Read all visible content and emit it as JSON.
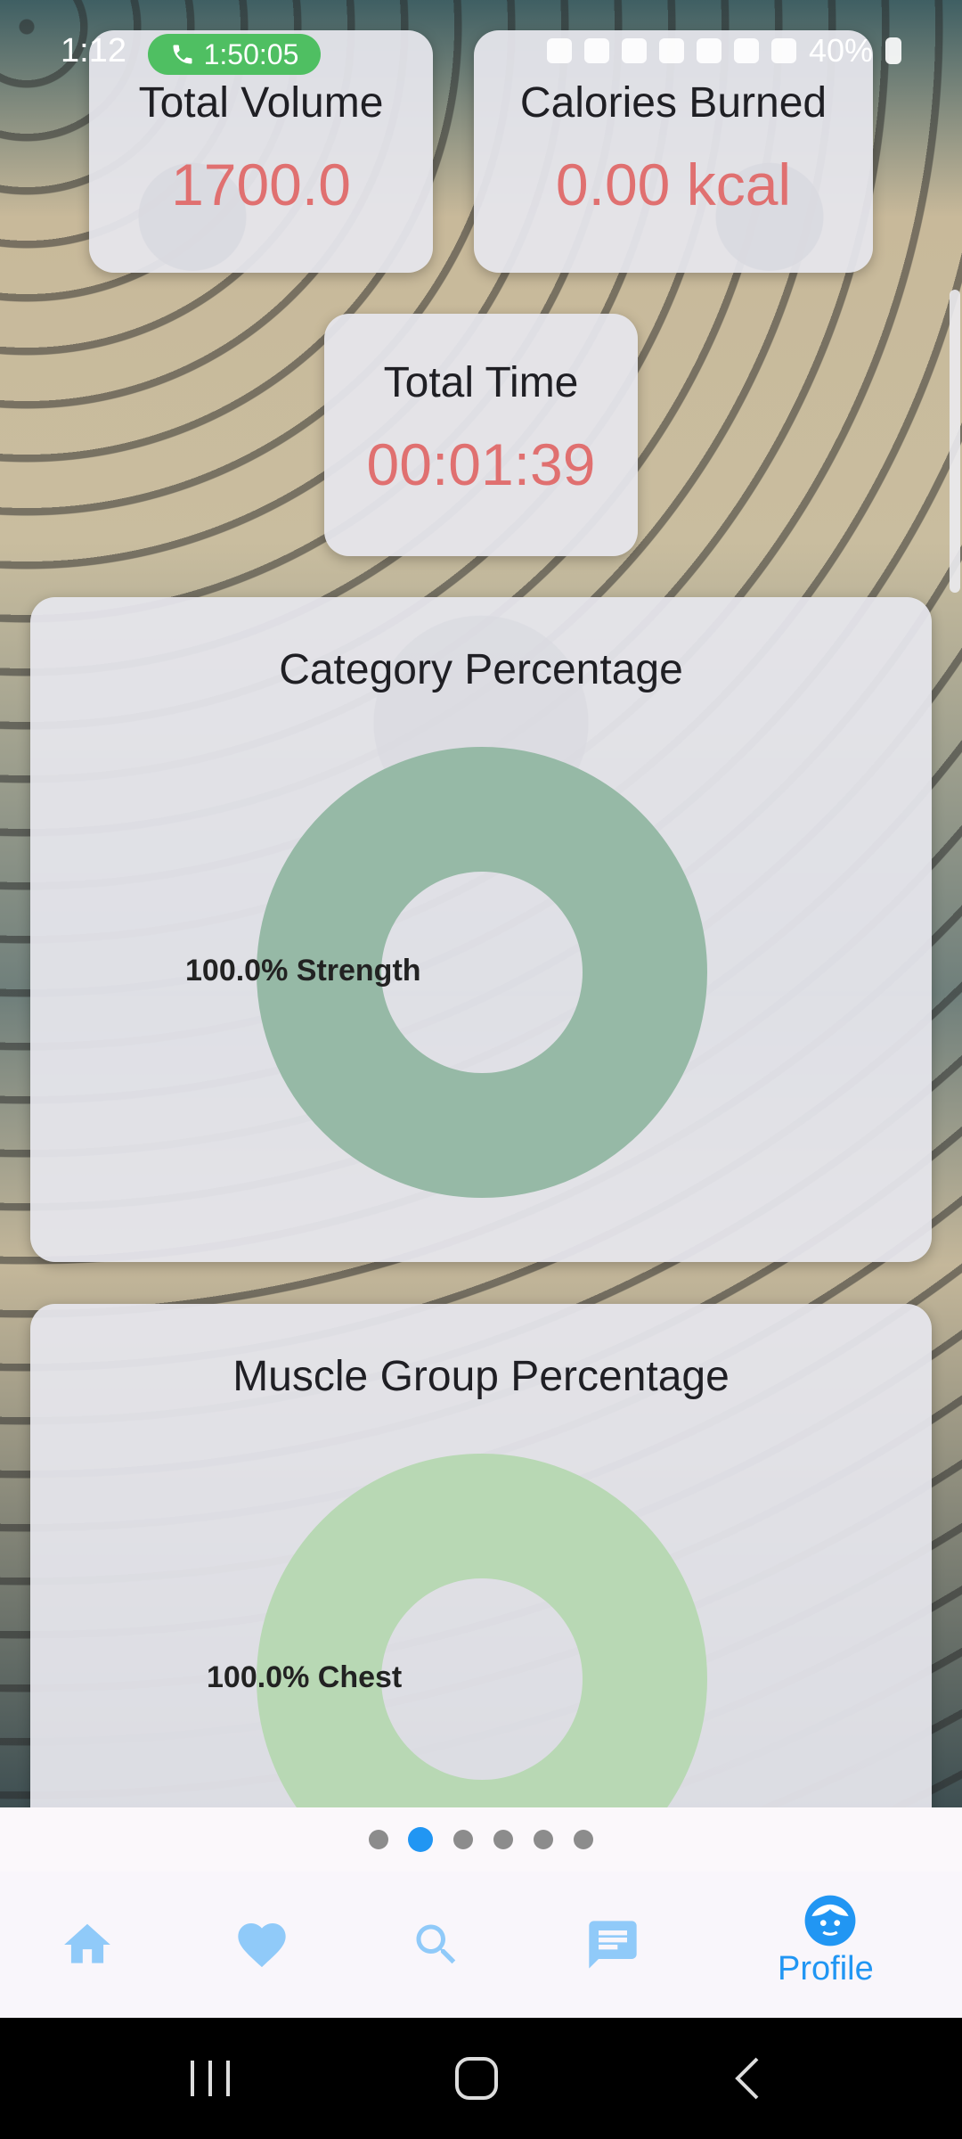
{
  "status_bar": {
    "time": "1:12",
    "call_timer": "1:50:05",
    "battery": "40%"
  },
  "stats": {
    "total_volume": {
      "title": "Total Volume",
      "value": "1700.0"
    },
    "calories": {
      "title": "Calories Burned",
      "value": "0.00 kcal"
    },
    "total_time": {
      "title": "Total Time",
      "value": "00:01:39"
    }
  },
  "category_chart": {
    "title": "Category Percentage",
    "label": "100.0% Strength"
  },
  "muscle_chart": {
    "title": "Muscle Group Percentage",
    "label": "100.0% Chest"
  },
  "chart_data": [
    {
      "type": "pie",
      "title": "Category Percentage",
      "categories": [
        "Strength"
      ],
      "values": [
        100.0
      ],
      "colors": [
        "#96b9a6"
      ]
    },
    {
      "type": "pie",
      "title": "Muscle Group Percentage",
      "categories": [
        "Chest"
      ],
      "values": [
        100.0
      ],
      "colors": [
        "#b8d8b4"
      ]
    }
  ],
  "page_indicator": {
    "count": 6,
    "active_index": 1
  },
  "bottom_nav": {
    "items": [
      {
        "icon": "home-icon"
      },
      {
        "icon": "heart-icon"
      },
      {
        "icon": "search-icon"
      },
      {
        "icon": "chat-icon"
      },
      {
        "icon": "profile-icon",
        "label": "Profile",
        "active": true
      }
    ]
  },
  "colors": {
    "accent": "#2196f3",
    "nav_inactive": "#90caf9",
    "stat_value": "#e07070",
    "strength_slice": "#96b9a6",
    "chest_slice": "#b8d8b4"
  }
}
